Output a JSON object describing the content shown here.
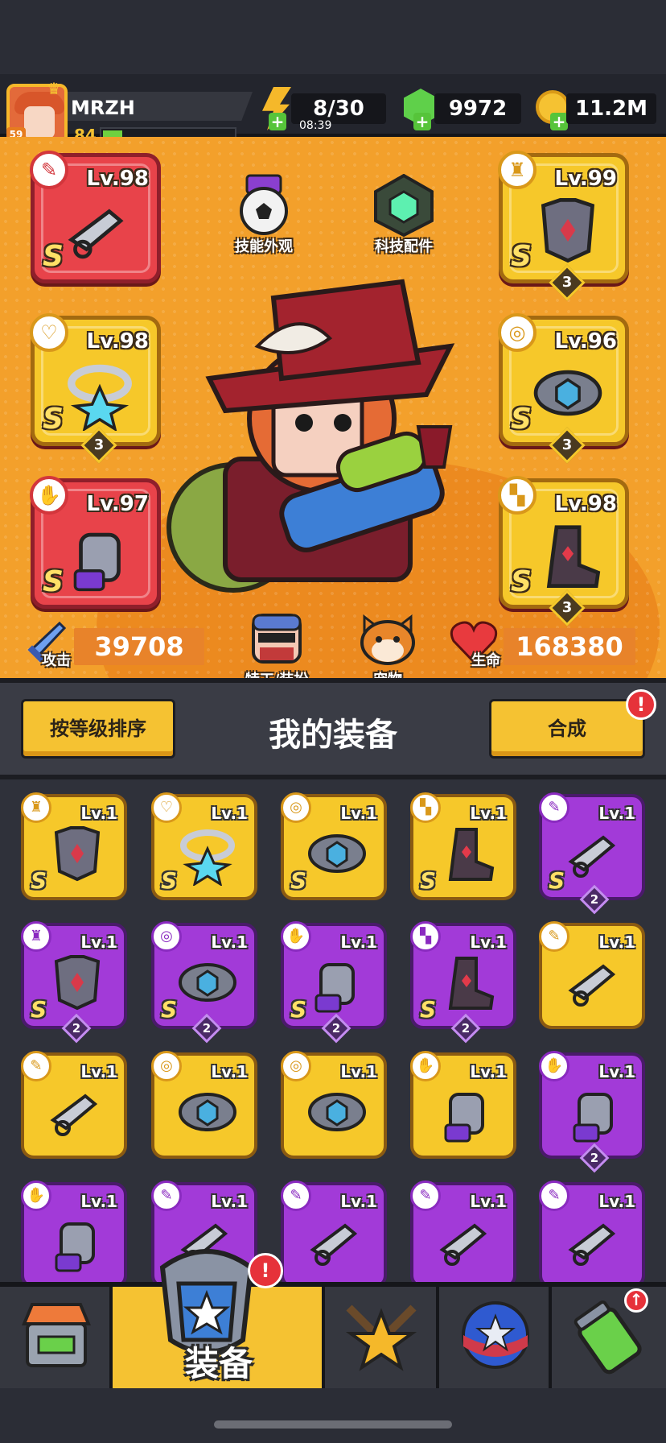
{
  "player": {
    "name": "MRZH",
    "vip": "59",
    "level": "84",
    "xp_fraction": 0.15
  },
  "resources": {
    "energy": "8/30",
    "energy_timer": "08:39",
    "gems": "9972",
    "coins": "11.2M"
  },
  "hero": {
    "skin_label": "技能外观",
    "tech_label": "科技配件",
    "agent_label": "特工/装扮",
    "pet_label": "宠物",
    "attack_label": "攻击",
    "attack_value": "39708",
    "hp_label": "生命",
    "hp_value": "168380",
    "slots": [
      {
        "lv": "Lv.98",
        "rank": "S",
        "stars": "",
        "icon": "weapon-icon",
        "color": "red"
      },
      {
        "lv": "Lv.99",
        "rank": "S",
        "stars": "3",
        "icon": "armor-icon",
        "color": "gold"
      },
      {
        "lv": "Lv.98",
        "rank": "S",
        "stars": "3",
        "icon": "necklace-icon",
        "color": "gold"
      },
      {
        "lv": "Lv.96",
        "rank": "S",
        "stars": "3",
        "icon": "belt-icon",
        "color": "gold"
      },
      {
        "lv": "Lv.97",
        "rank": "S",
        "stars": "",
        "icon": "glove-icon",
        "color": "red"
      },
      {
        "lv": "Lv.98",
        "rank": "S",
        "stars": "3",
        "icon": "boot-icon",
        "color": "gold"
      }
    ]
  },
  "equip_header": {
    "sort_label": "按等级排序",
    "title": "我的装备",
    "merge_label": "合成",
    "alert": "!"
  },
  "grid": [
    {
      "lv": "Lv.1",
      "rank": "S",
      "cnt": "",
      "type": "armor-icon",
      "color": "y"
    },
    {
      "lv": "Lv.1",
      "rank": "S",
      "cnt": "",
      "type": "necklace-icon",
      "color": "y"
    },
    {
      "lv": "Lv.1",
      "rank": "S",
      "cnt": "",
      "type": "belt-icon",
      "color": "y"
    },
    {
      "lv": "Lv.1",
      "rank": "S",
      "cnt": "",
      "type": "boot-icon",
      "color": "y"
    },
    {
      "lv": "Lv.1",
      "rank": "S",
      "cnt": "2",
      "type": "weapon-icon",
      "color": "p"
    },
    {
      "lv": "Lv.1",
      "rank": "S",
      "cnt": "2",
      "type": "armor-icon",
      "color": "p"
    },
    {
      "lv": "Lv.1",
      "rank": "S",
      "cnt": "2",
      "type": "belt-icon",
      "color": "p"
    },
    {
      "lv": "Lv.1",
      "rank": "S",
      "cnt": "2",
      "type": "glove-icon",
      "color": "p"
    },
    {
      "lv": "Lv.1",
      "rank": "S",
      "cnt": "2",
      "type": "boot-icon",
      "color": "p"
    },
    {
      "lv": "Lv.1",
      "rank": "",
      "cnt": "",
      "type": "weapon-icon",
      "color": "y"
    },
    {
      "lv": "Lv.1",
      "rank": "",
      "cnt": "",
      "type": "weapon-icon",
      "color": "y"
    },
    {
      "lv": "Lv.1",
      "rank": "",
      "cnt": "",
      "type": "belt-icon",
      "color": "y"
    },
    {
      "lv": "Lv.1",
      "rank": "",
      "cnt": "",
      "type": "belt-icon",
      "color": "y"
    },
    {
      "lv": "Lv.1",
      "rank": "",
      "cnt": "",
      "type": "glove-icon",
      "color": "y"
    },
    {
      "lv": "Lv.1",
      "rank": "",
      "cnt": "2",
      "type": "glove-icon",
      "color": "p"
    },
    {
      "lv": "Lv.1",
      "rank": "",
      "cnt": "",
      "type": "glove-icon",
      "color": "p"
    },
    {
      "lv": "Lv.1",
      "rank": "",
      "cnt": "",
      "type": "weapon-icon",
      "color": "p"
    },
    {
      "lv": "Lv.1",
      "rank": "",
      "cnt": "",
      "type": "weapon-icon",
      "color": "p"
    },
    {
      "lv": "Lv.1",
      "rank": "",
      "cnt": "",
      "type": "weapon-icon",
      "color": "p"
    },
    {
      "lv": "Lv.1",
      "rank": "",
      "cnt": "",
      "type": "weapon-icon",
      "color": "p"
    }
  ],
  "nav": {
    "shop_icon": "shop-icon",
    "equip_label": "装备",
    "equip_alert": "!",
    "battle_icon": "battle-icon",
    "gacha_icon": "gacha-icon",
    "lab_icon": "lab-icon"
  },
  "colors": {
    "gold": "#f6c82a",
    "purple": "#a23ad8",
    "red": "#e8434a",
    "hero_bg": "#f3a02b"
  }
}
